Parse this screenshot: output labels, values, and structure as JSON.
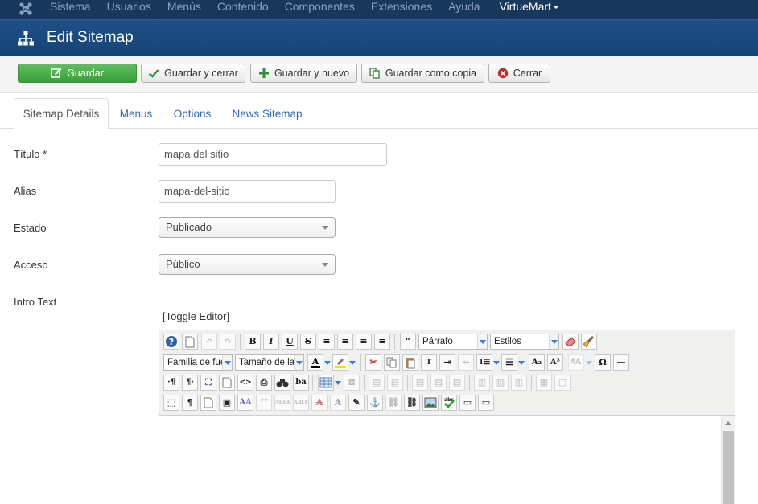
{
  "navbar": {
    "menu": [
      "Sistema",
      "Usuarios",
      "Menús",
      "Contenido",
      "Componentes",
      "Extensiones",
      "Ayuda"
    ],
    "virtuemart": "VirtueMart"
  },
  "header": {
    "title": "Edit Sitemap"
  },
  "toolbar": {
    "save": "Guardar",
    "save_close": "Guardar y cerrar",
    "save_new": "Guardar y nuevo",
    "save_copy": "Guardar como copia",
    "close": "Cerrar"
  },
  "tabs": [
    "Sitemap Details",
    "Menus",
    "Options",
    "News Sitemap"
  ],
  "form": {
    "title_label": "Título *",
    "title_value": "mapa del sitio",
    "alias_label": "Alias",
    "alias_value": "mapa-del-sitio",
    "status_label": "Estado",
    "status_value": "Publicado",
    "access_label": "Acceso",
    "access_value": "Público",
    "intro_label": "Intro Text",
    "toggle_editor": "[Toggle Editor]"
  },
  "editor": {
    "format_value": "Párrafo",
    "styles_value": "Estilos",
    "font_family_value": "Familia de fue",
    "font_size_value": "Tamaño de la"
  },
  "colors": {
    "navbar_bg": "#17385a",
    "header_bg": "#1d4f86",
    "primary_btn": "#46a546",
    "link": "#2a6bb8"
  }
}
